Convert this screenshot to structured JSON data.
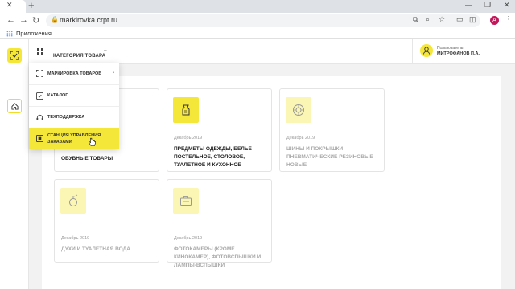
{
  "browser": {
    "url": "markirovka.crpt.ru",
    "bookmarks_apps_label": "Приложения",
    "profile_initial": "A"
  },
  "header": {
    "category_button": "КАТЕГОРИЯ ТОВАРА",
    "user_role": "Пользователь",
    "user_name": "МИТРОФАНОВ П.А."
  },
  "dropdown": {
    "items": [
      {
        "label": "МАРКИРОВКА ТОВАРОВ",
        "icon": "scan-icon",
        "has_submenu": true
      },
      {
        "label": "КАТАЛОГ",
        "icon": "catalog-icon"
      },
      {
        "label": "ТЕХПОДДЕРЖКА",
        "icon": "support-icon"
      },
      {
        "label": "СТАНЦИЯ УПРАВЛЕНИЯ ЗАКАЗАМИ",
        "icon": "station-icon",
        "highlighted": true
      }
    ]
  },
  "cards": [
    {
      "title": "ОБУВНЫЕ ТОВАРЫ",
      "date": "",
      "active": true,
      "icon": "shoe-icon"
    },
    {
      "title": "ПРЕДМЕТЫ ОДЕЖДЫ, БЕЛЬЕ ПОСТЕЛЬНОЕ, СТОЛОВОЕ, ТУАЛЕТНОЕ И КУХОННОЕ",
      "date": "Декабрь 2019",
      "active": true,
      "icon": "clothes-icon"
    },
    {
      "title": "ШИНЫ И ПОКРЫШКИ ПНЕВМАТИЧЕСКИЕ РЕЗИНОВЫЕ НОВЫЕ",
      "date": "Декабрь 2019",
      "active": false,
      "icon": "tire-icon"
    },
    {
      "title": "ДУХИ И ТУАЛЕТНАЯ ВОДА",
      "date": "Декабрь 2019",
      "active": false,
      "icon": "perfume-icon"
    },
    {
      "title": "ФОТОКАМЕРЫ (КРОМЕ КИНОКАМЕР), ФОТОВСПЫШКИ И ЛАМПЫ-ВСПЫШКИ",
      "date": "Декабрь 2019",
      "active": false,
      "icon": "camera-icon"
    }
  ],
  "colors": {
    "accent": "#f5e63a",
    "accent_dim": "#fbf6b4",
    "profile": "#c2185b"
  }
}
